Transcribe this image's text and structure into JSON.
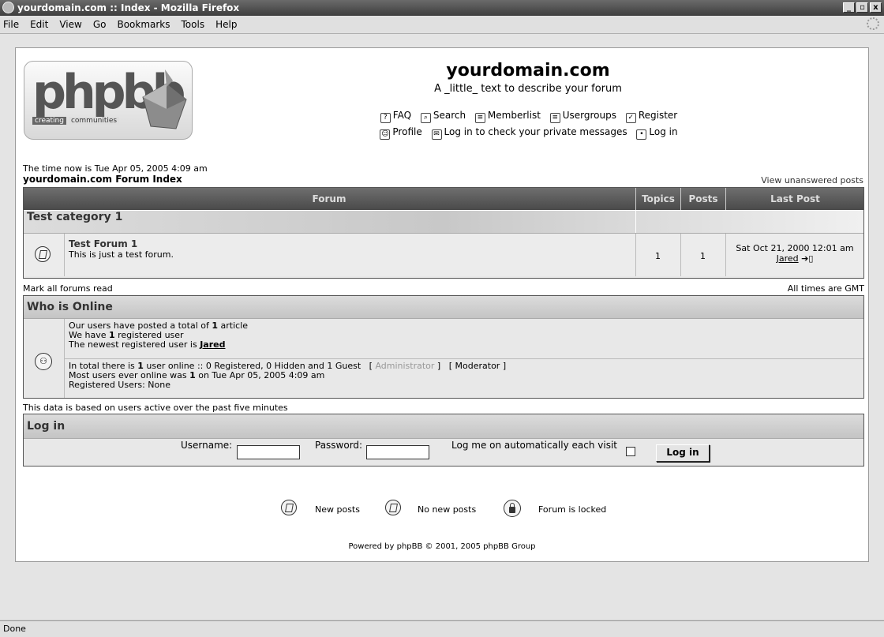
{
  "window": {
    "title": "yourdomain.com :: Index - Mozilla Firefox",
    "buttons": [
      "_",
      "▫",
      "x"
    ]
  },
  "menu": [
    "File",
    "Edit",
    "View",
    "Go",
    "Bookmarks",
    "Tools",
    "Help"
  ],
  "header": {
    "logo_text": "phpbb",
    "logo_tag1": "creating",
    "logo_tag2": "communities",
    "site_title": "yourdomain.com",
    "site_desc": "A _little_ text to describe your forum",
    "nav_row1": [
      {
        "label": "FAQ",
        "icon": "faq-icon",
        "glyph": "?"
      },
      {
        "label": "Search",
        "icon": "search-icon",
        "glyph": "⌕"
      },
      {
        "label": "Memberlist",
        "icon": "memberlist-icon",
        "glyph": "≡"
      },
      {
        "label": "Usergroups",
        "icon": "usergroups-icon",
        "glyph": "≡"
      },
      {
        "label": "Register",
        "icon": "register-icon",
        "glyph": "✓"
      }
    ],
    "nav_row2": [
      {
        "label": "Profile",
        "icon": "profile-icon",
        "glyph": "☺"
      },
      {
        "label": "Log in to check your private messages",
        "icon": "messages-icon",
        "glyph": "✉"
      },
      {
        "label": "Log in",
        "icon": "login-icon",
        "glyph": "•"
      }
    ]
  },
  "time_text": "The time now is Tue Apr 05, 2005 4:09 am",
  "index_title": "yourdomain.com Forum Index",
  "unanswered": "View unanswered posts",
  "forum_table": {
    "headers": [
      "Forum",
      "Topics",
      "Posts",
      "Last Post"
    ],
    "category": "Test category 1",
    "forum": {
      "name": "Test Forum 1",
      "desc": "This is just a test forum.",
      "topics": "1",
      "posts": "1",
      "last_post_date": "Sat Oct 21, 2000 12:01 am",
      "last_post_user": "Jared",
      "last_post_arrow": "➔▯"
    }
  },
  "mark_read": "Mark all forums read",
  "all_times": "All times are GMT",
  "who_is_online": {
    "title": "Who is Online",
    "line1_pre": "Our users have posted a total of ",
    "line1_num": "1",
    "line1_post": " article",
    "line2_pre": "We have ",
    "line2_num": "1",
    "line2_post": " registered user",
    "line3_pre": "The newest registered user is ",
    "line3_user": "Jared",
    "line4_pre": "In total there is ",
    "line4_num": "1",
    "line4_post": " user online :: 0 Registered, 0 Hidden and 1 Guest",
    "line4_admin": "Administrator",
    "line4_mod": "Moderator",
    "line5_pre": "Most users ever online was ",
    "line5_num": "1",
    "line5_post": " on Tue Apr 05, 2005 4:09 am",
    "line6": "Registered Users: None"
  },
  "data_note": "This data is based on users active over the past five minutes",
  "login": {
    "title": "Log in",
    "username_label": "Username:",
    "password_label": "Password:",
    "auto_label": "Log me on automatically each visit",
    "button": "Log in"
  },
  "legend": {
    "new_posts": "New posts",
    "no_new_posts": "No new posts",
    "locked": "Forum is locked"
  },
  "footer": "Powered by phpBB © 2001, 2005 phpBB Group",
  "status": "Done"
}
